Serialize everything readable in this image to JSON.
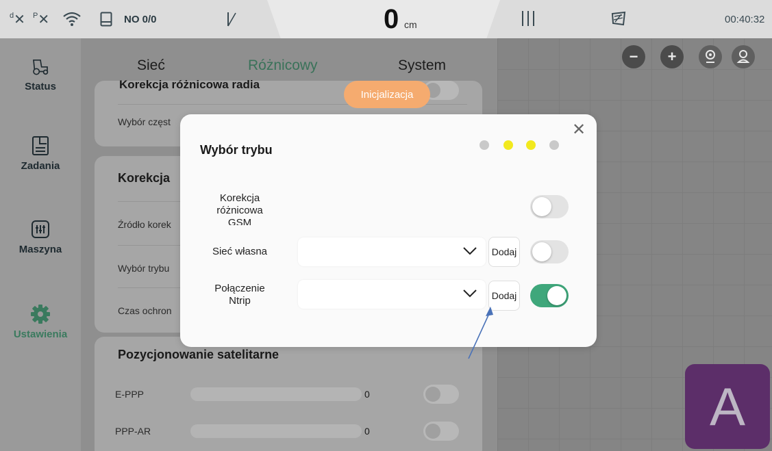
{
  "status_bar": {
    "d_label": "d",
    "p_label": "P",
    "no_text": "NO 0/0",
    "center_value": "0",
    "center_unit": "cm",
    "time": "00:40:32"
  },
  "sidebar": {
    "items": [
      {
        "label": "Status"
      },
      {
        "label": "Zadania"
      },
      {
        "label": "Maszyna"
      },
      {
        "label": "Ustawienia"
      }
    ]
  },
  "tabs": [
    "Sieć",
    "Różnicowy",
    "System"
  ],
  "background_panel": {
    "header_partial": "Korekcja różnicowa radia",
    "row_wybor_czest": "Wybór częst",
    "section_korekcja": "Korekcja",
    "row_zrodlo": "Źródło korek",
    "row_wybor_trybu": "Wybór trybu",
    "row_czas": "Czas ochron",
    "section_pozycjonowanie": "Pozycjonowanie satelitarne",
    "satellite_rows": [
      {
        "label": "E-PPP",
        "value": "0"
      },
      {
        "label": "PPP-AR",
        "value": "0"
      }
    ]
  },
  "init_pill": "Inicjalizacja",
  "modal": {
    "title": "Wybór trybu",
    "step_dots": [
      "#c9c9c9",
      "#f2e91e",
      "#f2e91e",
      "#c9c9c9"
    ],
    "rows": [
      {
        "label_line1": "Korekcja",
        "label_line2": "różnicowa",
        "label_line3": "GSM",
        "toggle_on": false
      },
      {
        "label_line1": "Sieć własna",
        "select_value": "",
        "button": "Dodaj",
        "toggle_on": false
      },
      {
        "label_line1": "Połączenie",
        "label_line2": "Ntrip",
        "select_value": "",
        "button": "Dodaj",
        "toggle_on": true
      }
    ]
  },
  "map_tile": {
    "letter": "A"
  },
  "colors": {
    "accent_green": "#3fa77b",
    "init_orange": "#f5ab6f",
    "step_active": "#f2e91e",
    "tile_purple": "#5c2e69",
    "arrow_blue": "#4a72b8"
  }
}
